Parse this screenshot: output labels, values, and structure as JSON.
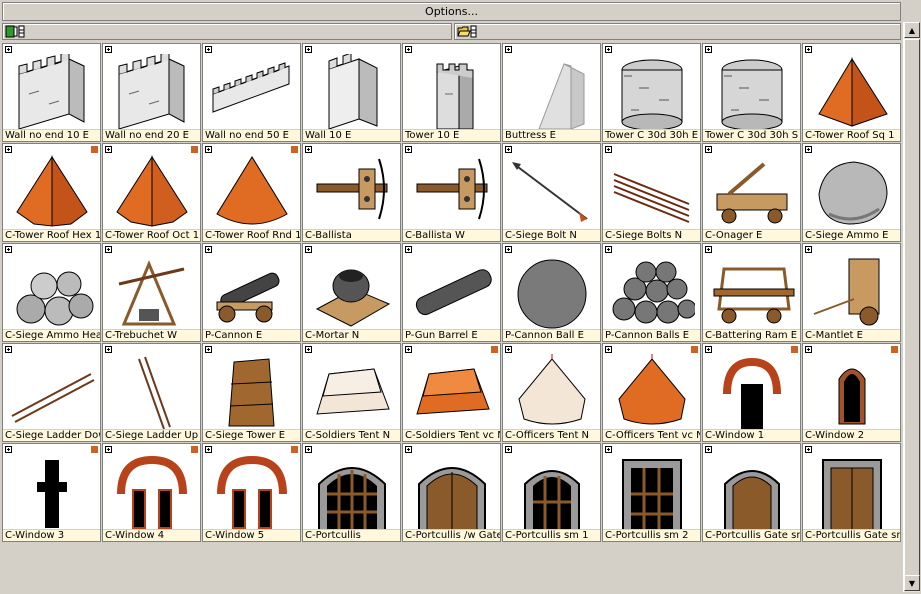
{
  "options_label": "Options...",
  "colors": {
    "accent_orange": "#e06b22",
    "corner_badge": "#c8642a",
    "label_bg": "#fff8dc"
  },
  "toolbar": {
    "left_icon": "library-icon",
    "right_icon": "folder-open-icon"
  },
  "items": [
    {
      "label": "Wall no end 10 E",
      "icon": "wall-icon",
      "corner": false
    },
    {
      "label": "Wall no end 20 E",
      "icon": "wall-icon",
      "corner": false
    },
    {
      "label": "Wall no end 50 E",
      "icon": "wall-long-icon",
      "corner": false
    },
    {
      "label": "Wall 10 E",
      "icon": "wall-block-icon",
      "corner": false
    },
    {
      "label": "Tower 10 E",
      "icon": "tower-icon",
      "corner": false
    },
    {
      "label": "Buttress E",
      "icon": "buttress-icon",
      "corner": false
    },
    {
      "label": "Tower C 30d 30h E",
      "icon": "round-tower-icon",
      "corner": false
    },
    {
      "label": "Tower C 30d 30h S",
      "icon": "round-tower-icon",
      "corner": false
    },
    {
      "label": "C-Tower Roof Sq 1",
      "icon": "pyramid-roof-icon",
      "corner": false
    },
    {
      "label": "C-Tower Roof Hex 1",
      "icon": "hex-roof-icon",
      "corner": true
    },
    {
      "label": "C-Tower Roof Oct 1",
      "icon": "oct-roof-icon",
      "corner": true
    },
    {
      "label": "C-Tower Roof Rnd 1",
      "icon": "cone-roof-icon",
      "corner": true
    },
    {
      "label": "C-Ballista",
      "icon": "ballista-icon",
      "corner": false
    },
    {
      "label": "C-Ballista W",
      "icon": "ballista-icon",
      "corner": false
    },
    {
      "label": "C-Siege Bolt N",
      "icon": "bolt-icon",
      "corner": false
    },
    {
      "label": "C-Siege Bolts N",
      "icon": "bolts-icon",
      "corner": false
    },
    {
      "label": "C-Onager E",
      "icon": "onager-icon",
      "corner": false
    },
    {
      "label": "C-Siege Ammo E",
      "icon": "rock-icon",
      "corner": false
    },
    {
      "label": "C-Siege Ammo Heap",
      "icon": "rock-heap-icon",
      "corner": false
    },
    {
      "label": "C-Trebuchet W",
      "icon": "trebuchet-icon",
      "corner": false
    },
    {
      "label": "P-Cannon E",
      "icon": "cannon-icon",
      "corner": false
    },
    {
      "label": "C-Mortar N",
      "icon": "mortar-icon",
      "corner": false
    },
    {
      "label": "P-Gun Barrel E",
      "icon": "gun-barrel-icon",
      "corner": false
    },
    {
      "label": "P-Cannon Ball E",
      "icon": "cannon-ball-icon",
      "corner": false
    },
    {
      "label": "P-Cannon Balls E",
      "icon": "cannon-balls-icon",
      "corner": false
    },
    {
      "label": "C-Battering Ram E",
      "icon": "ram-icon",
      "corner": false
    },
    {
      "label": "C-Mantlet E",
      "icon": "mantlet-icon",
      "corner": false
    },
    {
      "label": "C-Siege Ladder Down",
      "icon": "ladder-down-icon",
      "corner": false
    },
    {
      "label": "C-Siege Ladder Up",
      "icon": "ladder-up-icon",
      "corner": false
    },
    {
      "label": "C-Siege Tower E",
      "icon": "siege-tower-icon",
      "corner": false
    },
    {
      "label": "C-Soldiers Tent N",
      "icon": "tent-plain-icon",
      "corner": false
    },
    {
      "label": "C-Soldiers Tent vc N",
      "icon": "tent-orange-icon",
      "corner": true
    },
    {
      "label": "C-Officers Tent N",
      "icon": "round-tent-plain-icon",
      "corner": false
    },
    {
      "label": "C-Officers Tent vc N",
      "icon": "round-tent-orange-icon",
      "corner": true
    },
    {
      "label": "C-Window 1",
      "icon": "window-arch-icon",
      "corner": true
    },
    {
      "label": "C-Window 2",
      "icon": "window-narrow-icon",
      "corner": true
    },
    {
      "label": "C-Window 3",
      "icon": "window-cross-icon",
      "corner": true
    },
    {
      "label": "C-Window 4",
      "icon": "window-double-icon",
      "corner": true
    },
    {
      "label": "C-Window 5",
      "icon": "window-double-icon",
      "corner": true
    },
    {
      "label": "C-Portcullis",
      "icon": "portcullis-icon",
      "corner": false
    },
    {
      "label": "C-Portcullis /w Gate",
      "icon": "portcullis-gate-icon",
      "corner": false
    },
    {
      "label": "C-Portcullis sm 1",
      "icon": "portcullis-sm-icon",
      "corner": false
    },
    {
      "label": "C-Portcullis sm 2",
      "icon": "portcullis-sq-icon",
      "corner": false
    },
    {
      "label": "C-Portcullis Gate sm",
      "icon": "portcullis-gate-sm-icon",
      "corner": false
    },
    {
      "label": "C-Portcullis Gate sm",
      "icon": "portcullis-gate-sq-icon",
      "corner": false
    }
  ]
}
